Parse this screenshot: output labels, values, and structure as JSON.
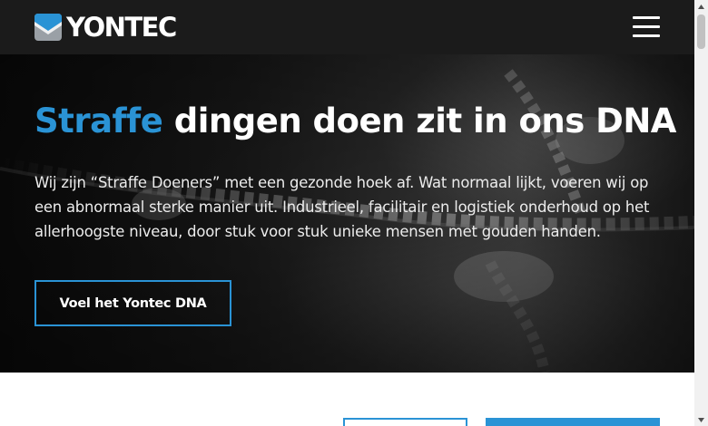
{
  "header": {
    "logo_text": "YONTEC",
    "menu_icon": "hamburger-menu-icon"
  },
  "hero": {
    "title_accent": "Straffe",
    "title_rest": "dingen doen zit in ons DNA",
    "intro": "Wij zijn “Straffe Doeners” met een gezonde hoek af. Wat normaal lijkt, voeren wij op een abnormaal sterke manier uit. Industrieel, facilitair en logistiek onderhoud op het allerhoogste niveau, door stuk voor stuk unieke mensen met gouden handen.",
    "cta_label": "Voel het Yontec DNA"
  },
  "colors": {
    "accent": "#2a93d5",
    "header_bg": "#1b1b1b"
  }
}
